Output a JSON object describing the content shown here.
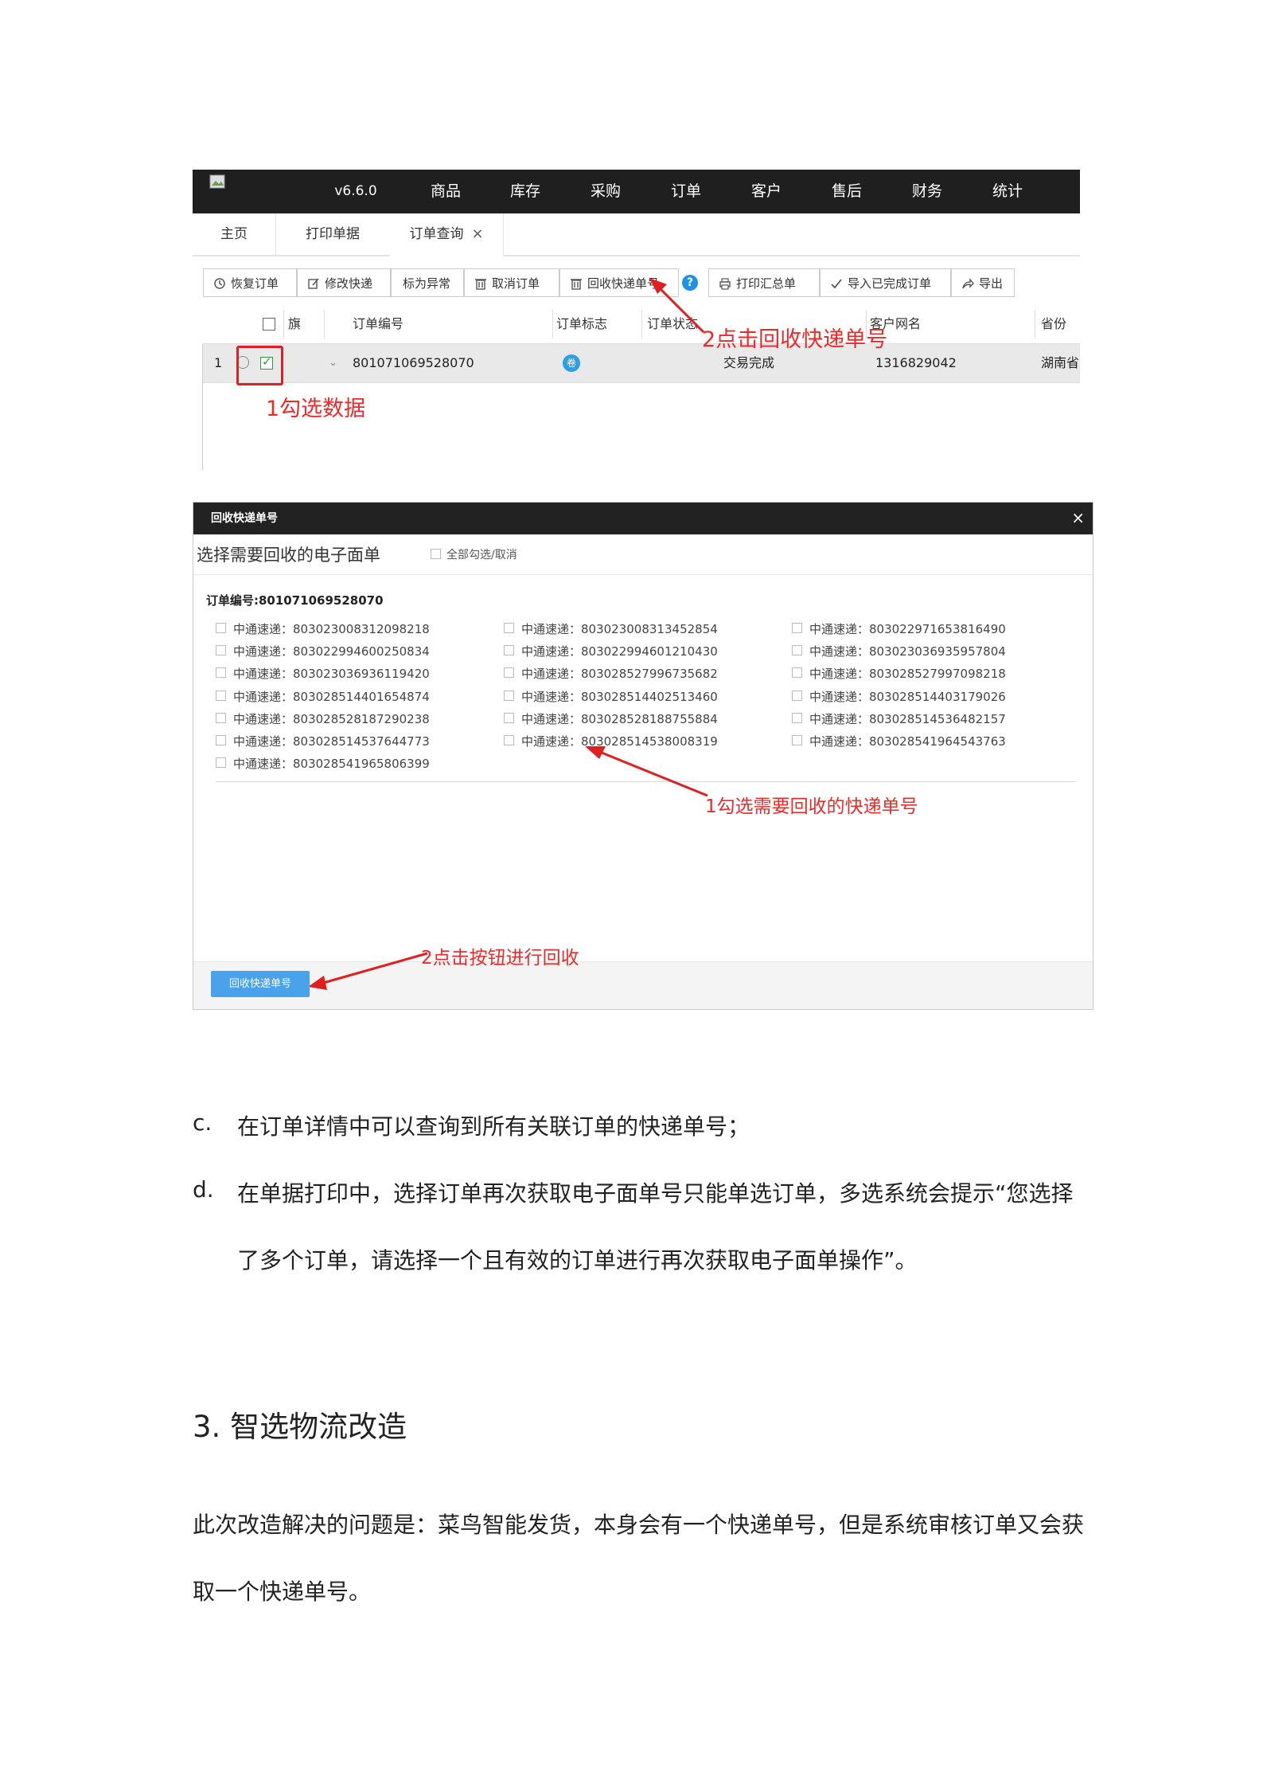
{
  "screenshot1": {
    "nav": {
      "version": "v6.6.0",
      "items": [
        "商品",
        "库存",
        "采购",
        "订单",
        "客户",
        "售后",
        "财务",
        "统计"
      ]
    },
    "tabs": [
      "主页",
      "打印单据",
      "订单查询"
    ],
    "tab_close": "×",
    "toolbar": [
      "恢复订单",
      "修改快递",
      "标为异常",
      "取消订单",
      "回收快递单号",
      "打印汇总单",
      "导入已完成订单",
      "导出"
    ],
    "help_icon": "?",
    "columns": [
      "旗",
      "订单编号",
      "订单标志",
      "订单状态",
      "客户网名",
      "省份"
    ],
    "row": {
      "index": "1",
      "order_no": "801071069528070",
      "flag_badge": "卷",
      "status": "交易完成",
      "customer": "1316829042",
      "province": "湖南省"
    },
    "annotations": {
      "step1": "1勾选数据",
      "step2": "2点击回收快递单号"
    }
  },
  "dialog": {
    "title": "回收快递单号",
    "close": "×",
    "subtitle": "选择需要回收的电子面单",
    "select_all": "全部勾选/取消",
    "order_label": "订单编号:801071069528070",
    "items": [
      "中通速递：803023008312098218",
      "中通速递：803023008313452854",
      "中通速递：803022971653816490",
      "中通速递：803022994600250834",
      "中通速递：803022994601210430",
      "中通速递：803023036935957804",
      "中通速递：803023036936119420",
      "中通速递：803028527996735682",
      "中通速递：803028527997098218",
      "中通速递：803028514401654874",
      "中通速递：803028514402513460",
      "中通速递：803028514403179026",
      "中通速递：803028528187290238",
      "中通速递：803028528188755884",
      "中通速递：803028514536482157",
      "中通速递：803028514537644773",
      "中通速递：803028514538008319",
      "中通速递：803028541964543763",
      "中通速递：803028541965806399"
    ],
    "button": "回收快递单号",
    "annotations": {
      "step1": "1勾选需要回收的快递单号",
      "step2": "2点击按钮进行回收"
    }
  },
  "document": {
    "item_c_marker": "c.",
    "item_c": "在订单详情中可以查询到所有关联订单的快递单号；",
    "item_d_marker": "d.",
    "item_d_line1": "在单据打印中，选择订单再次获取电子面单号只能单选订单，多选系统会提示“您选择",
    "item_d_line2": "了多个订单，请选择一个且有效的订单进行再次获取电子面单操作”。",
    "heading": "3. 智选物流改造",
    "para_line1": "此次改造解决的问题是：菜鸟智能发货，本身会有一个快递单号，但是系统审核订单又会获",
    "para_line2": "取一个快递单号。"
  },
  "colors": {
    "nav_bg": "#1f1f1f",
    "annotation_red": "#ea2b2b",
    "button_blue": "#4aa3ea",
    "help_blue": "#1f8fe8"
  }
}
